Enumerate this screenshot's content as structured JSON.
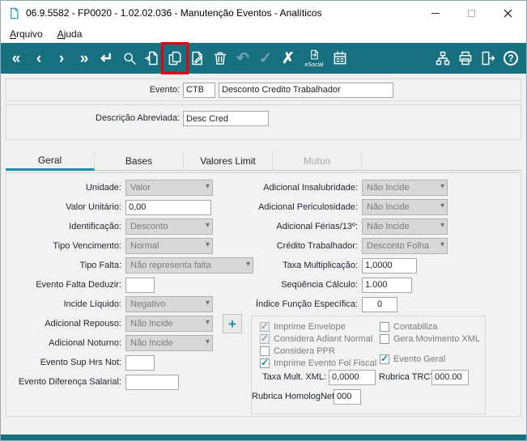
{
  "titlebar": {
    "title": "06.9.5582 - FP0020 - 1.02.02.036 - Manutenção Eventos - Analíticos"
  },
  "menu": {
    "arquivo": "Arquivo",
    "ajuda": "Ajuda"
  },
  "toolbar": {
    "glyphs": {
      "first": "«",
      "prev": "‹",
      "next": "›",
      "last": "»",
      "enter": "↵",
      "undo": "↶",
      "confirm": "✓",
      "cancel": "✗",
      "help": "?",
      "plus": "+"
    },
    "esocial_label": "eSocial"
  },
  "header": {
    "evento_label": "Evento:",
    "evento_code": "CTB",
    "evento_description": "Desconto Credito Trabalhador",
    "descricao_abreviada_label": "Descrição Abreviada:",
    "descricao_abreviada_value": "Desc Cred"
  },
  "tabs": {
    "geral": "Geral",
    "bases": "Bases",
    "valores_limit": "Valores Limit",
    "mutuo": "Mutuo"
  },
  "fields": {
    "unidade": {
      "label": "Unidade:",
      "value": "Valor"
    },
    "valor_unitario": {
      "label": "Valor Unitário:",
      "value": "0,00"
    },
    "identificacao": {
      "label": "Identificação:",
      "value": "Desconto"
    },
    "tipo_vencimento": {
      "label": "Tipo Vencimento:",
      "value": "Normal"
    },
    "tipo_falta": {
      "label": "Tipo Falta:",
      "value": "Não representa falta"
    },
    "evento_falta_deduzir": {
      "label": "Evento Falta Deduzir:",
      "value": ""
    },
    "incide_liquido": {
      "label": "Incide Líquido:",
      "value": "Negativo"
    },
    "adicional_repouso": {
      "label": "Adicional Repouso:",
      "value": "Não Incide"
    },
    "adicional_noturno": {
      "label": "Adicional Noturno:",
      "value": "Não Incide"
    },
    "evento_sup_hrs_not": {
      "label": "Evento Sup Hrs Not:",
      "value": ""
    },
    "evento_diferenca_salarial": {
      "label": "Evento Diferença Salarial:",
      "value": ""
    },
    "adicional_insalubridade": {
      "label": "Adicional Insalubridade:",
      "value": "Não Incide"
    },
    "adicional_periculosidade": {
      "label": "Adicional Periculosidade:",
      "value": "Não Incide"
    },
    "adicional_ferias_13": {
      "label": "Adicional Férias/13º:",
      "value": "Não Incide"
    },
    "credito_trabalhador": {
      "label": "Crédito Trabalhador:",
      "value": "Desconto Folha"
    },
    "taxa_multiplicacao": {
      "label": "Taxa Multiplicação:",
      "value": "1,0000"
    },
    "sequencia_calculo": {
      "label": "Seqüência Cálculo:",
      "value": "1.000"
    },
    "indice_funcao_especifica": {
      "label": "Índice Função Específica:",
      "value": "0"
    },
    "taxa_mult_xml": {
      "label": "Taxa Mult. XML:",
      "value": "0,0000"
    },
    "rubrica_trct": {
      "label": "Rubrica TRCT:",
      "value": "000.00"
    },
    "rubrica_homolognet": {
      "label": "Rubrica HomologNet:",
      "value": "000"
    }
  },
  "checkboxes": {
    "imprime_envelope": {
      "label": "Imprime Envelope",
      "checked": true
    },
    "considera_adiant_normal": {
      "label": "Considera Adiant Normal",
      "checked": true
    },
    "considera_ppr": {
      "label": "Considera PPR",
      "checked": false
    },
    "imprime_evento_fol_fiscal": {
      "label": "Imprime Evento Fol Fiscal",
      "checked": true
    },
    "contabiliza": {
      "label": "Contabiliza",
      "checked": false
    },
    "gera_movimento_xml": {
      "label": "Gera Movimento XML",
      "checked": false
    },
    "evento_geral": {
      "label": "Evento Geral",
      "checked": true
    }
  },
  "colors": {
    "toolbar_teal": "#17707f",
    "accent_teal": "#1a93a8",
    "highlight_red": "#e60012"
  }
}
